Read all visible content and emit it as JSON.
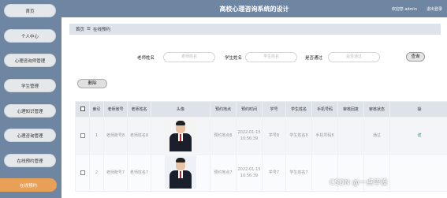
{
  "header": {
    "title": "高校心理咨询系统的设计",
    "welcome": "欢迎您 admin",
    "logout": "退出登录"
  },
  "sidebar": {
    "items": [
      {
        "label": "首页"
      },
      {
        "label": "个人中心"
      },
      {
        "label": "心理咨询师管理"
      },
      {
        "label": "学生管理"
      },
      {
        "label": "心理知识管理"
      },
      {
        "label": "心理咨询管理"
      },
      {
        "label": "在线预约管理"
      },
      {
        "label": "在线预约"
      }
    ]
  },
  "breadcrumb": {
    "home": "首页",
    "separator": "☰",
    "current": "在线预约"
  },
  "search": {
    "teacher_name_label": "老师姓名",
    "teacher_name_placeholder": "老师姓名",
    "student_name_label": "学生姓名",
    "student_name_placeholder": "学生姓名",
    "approved_label": "是否通过",
    "approved_placeholder": "是否通过",
    "query_button": "查询"
  },
  "actions": {
    "delete_button": "删除"
  },
  "table": {
    "headers": [
      "索引",
      "老师账号",
      "老师姓名",
      "头像",
      "预约地点",
      "预约时间",
      "学号",
      "学生姓名",
      "手机号码",
      "审核回复",
      "审核状态",
      "操"
    ],
    "rows": [
      {
        "index": "1",
        "teacher_account": "老师账号8",
        "teacher_name": "老师姓名8",
        "location": "预约地点8",
        "time": "2022-01-15 10:56:39",
        "student_id": "学号8",
        "student_name": "学生姓名8",
        "phone": "手机号码8",
        "reply": "",
        "status": "通过",
        "op": "详"
      },
      {
        "index": "2",
        "teacher_account": "老师账号7",
        "teacher_name": "老师姓名7",
        "location": "预约地点7",
        "time": "2022-01-15 10:56:39",
        "student_id": "学号7",
        "student_name": "学生姓名7",
        "phone": "",
        "reply": "",
        "status": "",
        "op": ""
      }
    ]
  },
  "watermark": "CSDN @一点毕设"
}
